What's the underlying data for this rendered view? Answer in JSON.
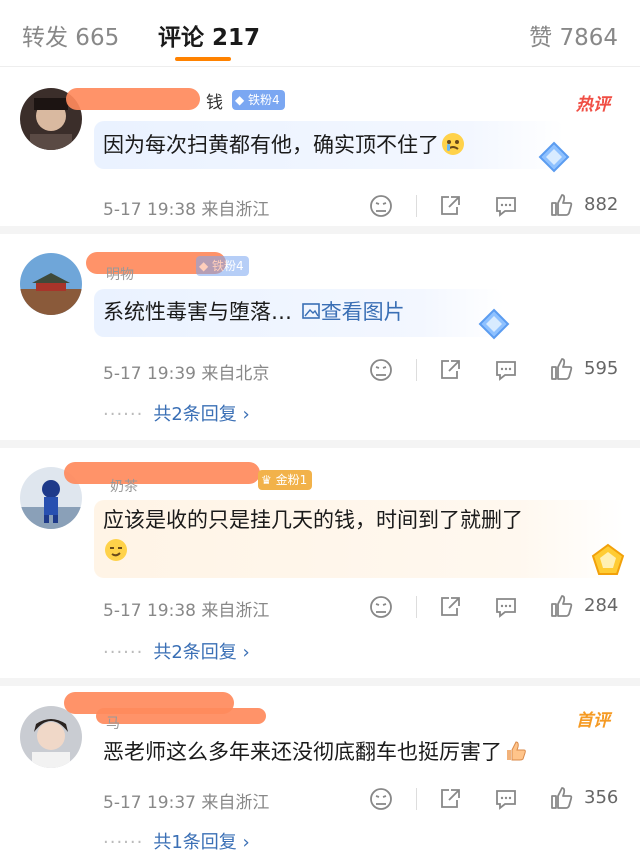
{
  "tabs": [
    {
      "label": "转发 665"
    },
    {
      "label": "评论 217"
    },
    {
      "label": "赞 7864"
    }
  ],
  "comments": [
    {
      "name_fragment": "钱",
      "badge": "铁粉4",
      "tag": "热评",
      "text": "因为每次扫黄都有他，确实顶不住了",
      "meta": "5-17 19:38 来自浙江",
      "likes": "882"
    },
    {
      "name_fragment": "明物",
      "badge": "铁粉4",
      "text": "系统性毒害与堕落…",
      "image_link": "查看图片",
      "meta": "5-17 19:39 来自北京",
      "likes": "595",
      "dots": "······",
      "replies": "共2条回复 ›"
    },
    {
      "name_fragment": "奶茶",
      "badge": "金粉1",
      "text_line1": "应该是收的只是挂几天的钱，时间到了就删了",
      "meta": "5-17 19:38 来自浙江",
      "likes": "284",
      "dots": "······",
      "replies": "共2条回复 ›"
    },
    {
      "name_fragment": "马",
      "tag": "首评",
      "text": "恶老师这么多年来还没彻底翻车也挺厉害了",
      "meta": "5-17 19:37 来自浙江",
      "likes": "356",
      "dots": "······",
      "replies": "共1条回复 ›"
    }
  ],
  "colors": {
    "accent": "#ff8200",
    "link": "#3a6fb5",
    "hot_tag": "#f04e44",
    "first_tag": "#f59a23",
    "redaction": "#ff8a5c"
  }
}
